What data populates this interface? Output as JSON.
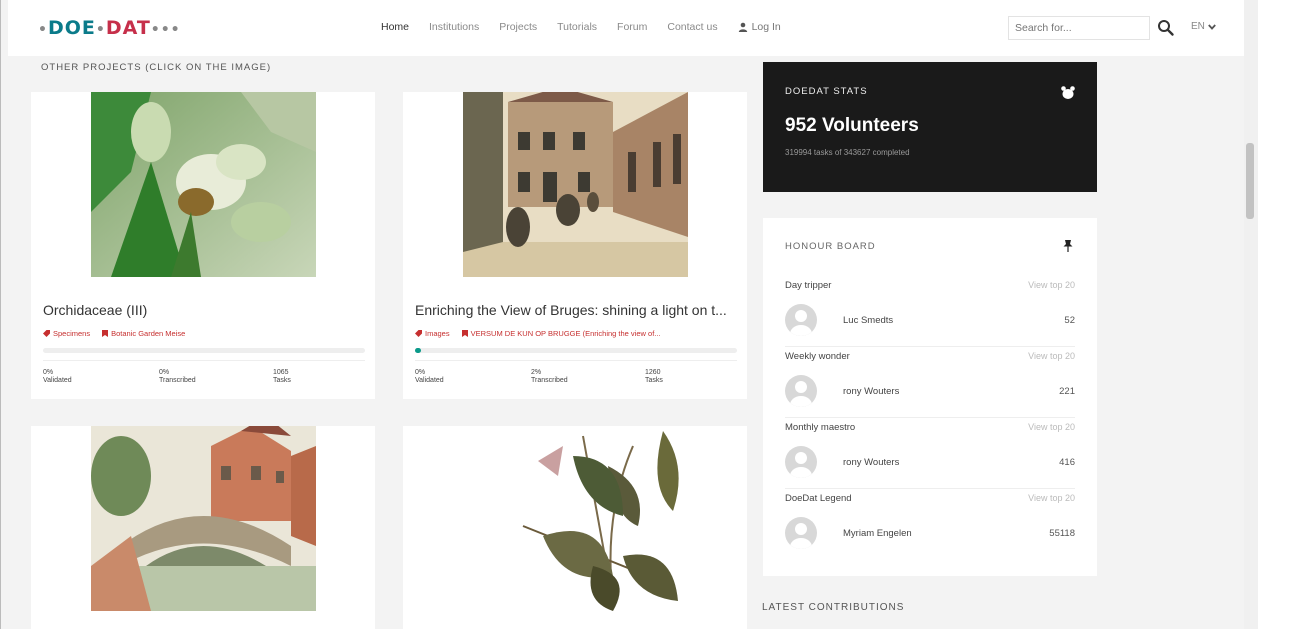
{
  "header": {
    "logo": {
      "p1": "DOE",
      "p2": "DAT"
    },
    "nav": [
      "Home",
      "Institutions",
      "Projects",
      "Tutorials",
      "Forum",
      "Contact us"
    ],
    "login": "Log In",
    "search_placeholder": "Search for...",
    "lang": "EN"
  },
  "section_title": "OTHER PROJECTS (CLICK ON THE IMAGE)",
  "projects": [
    {
      "title": "Orchidaceae (III)",
      "tags": [
        "Specimens",
        "Botanic Garden Meise"
      ],
      "progress": 0,
      "stats": [
        {
          "value": "0%",
          "label": "Validated"
        },
        {
          "value": "0%",
          "label": "Transcribed"
        },
        {
          "value": "1065",
          "label": "Tasks"
        }
      ]
    },
    {
      "title": "Enriching the View of Bruges: shining a light on t...",
      "tags": [
        "Images",
        "VERSUM DE KUN OP BRUGGE (Enriching the view of..."
      ],
      "progress": 0.02,
      "stats": [
        {
          "value": "0%",
          "label": "Validated"
        },
        {
          "value": "2%",
          "label": "Transcribed"
        },
        {
          "value": "1260",
          "label": "Tasks"
        }
      ]
    }
  ],
  "stats": {
    "label": "DOEDAT STATS",
    "volunteers": "952 Volunteers",
    "subtitle": "319994 tasks of 343627 completed"
  },
  "honour_board": {
    "title": "HONOUR BOARD",
    "view_top": "View top 20",
    "categories": [
      {
        "name": "Day tripper",
        "user": "Luc Smedts",
        "score": "52"
      },
      {
        "name": "Weekly wonder",
        "user": "rony Wouters",
        "score": "221"
      },
      {
        "name": "Monthly maestro",
        "user": "rony Wouters",
        "score": "416"
      },
      {
        "name": "DoeDat Legend",
        "user": "Myriam Engelen",
        "score": "55118"
      }
    ]
  },
  "latest_title": "LATEST CONTRIBUTIONS",
  "colors": {
    "teal": "#0b9a8a",
    "red": "#c62f2f",
    "dark_panel": "#1a1a1a"
  }
}
